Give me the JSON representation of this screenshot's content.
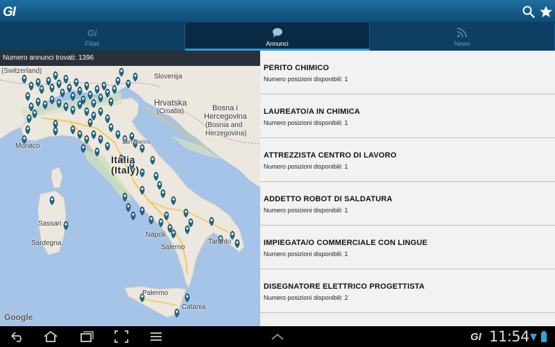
{
  "app": {
    "logo": "GI"
  },
  "actionbar": {
    "icons": [
      "search-icon",
      "star-icon"
    ]
  },
  "tabs": [
    {
      "label": "Filiali",
      "icon": "gi-icon",
      "active": false
    },
    {
      "label": "Annunci",
      "icon": "chat-bubble-icon",
      "active": true
    },
    {
      "label": "News",
      "icon": "rss-icon",
      "active": false
    }
  ],
  "map": {
    "count_label": "Numero annunci trovati: 1396",
    "labels": {
      "switzerland": "(Switzerland)",
      "slovenija": "Slovenija",
      "hrvatska": "Hrvatska",
      "croatia": "(Croatia)",
      "bosna": "Bosna i",
      "hercegovina": "Hercegovina",
      "bosnia": "(Bosnia and",
      "herzegovina": "Herzegovina)",
      "monaco": "Monaco",
      "san_marino": "San Marino",
      "italia": "Italia",
      "italy": "(Italy)",
      "sassari": "Sassari",
      "sardegna": "Sardegna",
      "napoli": "Napoli",
      "salerno": "Salerno",
      "taranto": "Taranto",
      "palermo": "Palermo",
      "catania": "Catania",
      "google": "Google"
    }
  },
  "jobs": [
    {
      "title": "PERITO CHIMICO",
      "positions": "Numero posizioni disponibili: 1"
    },
    {
      "title": "LAUREATO/A IN CHIMICA",
      "positions": "Numero posizioni disponibili: 1"
    },
    {
      "title": "ATTREZZISTA CENTRO DI LAVORO",
      "positions": "Numero posizioni disponibili: 1"
    },
    {
      "title": "ADDETTO ROBOT DI SALDATURA",
      "positions": "Numero posizioni disponibili: 1"
    },
    {
      "title": "IMPIEGATA/O COMMERCIALE CON LINGUE",
      "positions": "Numero posizioni disponibili: 1"
    },
    {
      "title": "DISEGNATORE ELETTRICO PROGETTISTA",
      "positions": "Numero posizioni disponibili: 2"
    }
  ],
  "systembar": {
    "time": "11:54",
    "logo": "GI",
    "icons": [
      "back-icon",
      "home-icon",
      "recent-apps-icon",
      "screenshot-icon",
      "menu-icon",
      "chevron-up-icon",
      "wifi-icon",
      "battery-icon"
    ]
  },
  "colors": {
    "actionbar": "#165d8c",
    "tabbar": "#0c3f63",
    "tab_indicator": "#2f9ad8",
    "sea": "#a6c3e8",
    "land": "#ece8df",
    "marker": "#1f6b8a"
  }
}
